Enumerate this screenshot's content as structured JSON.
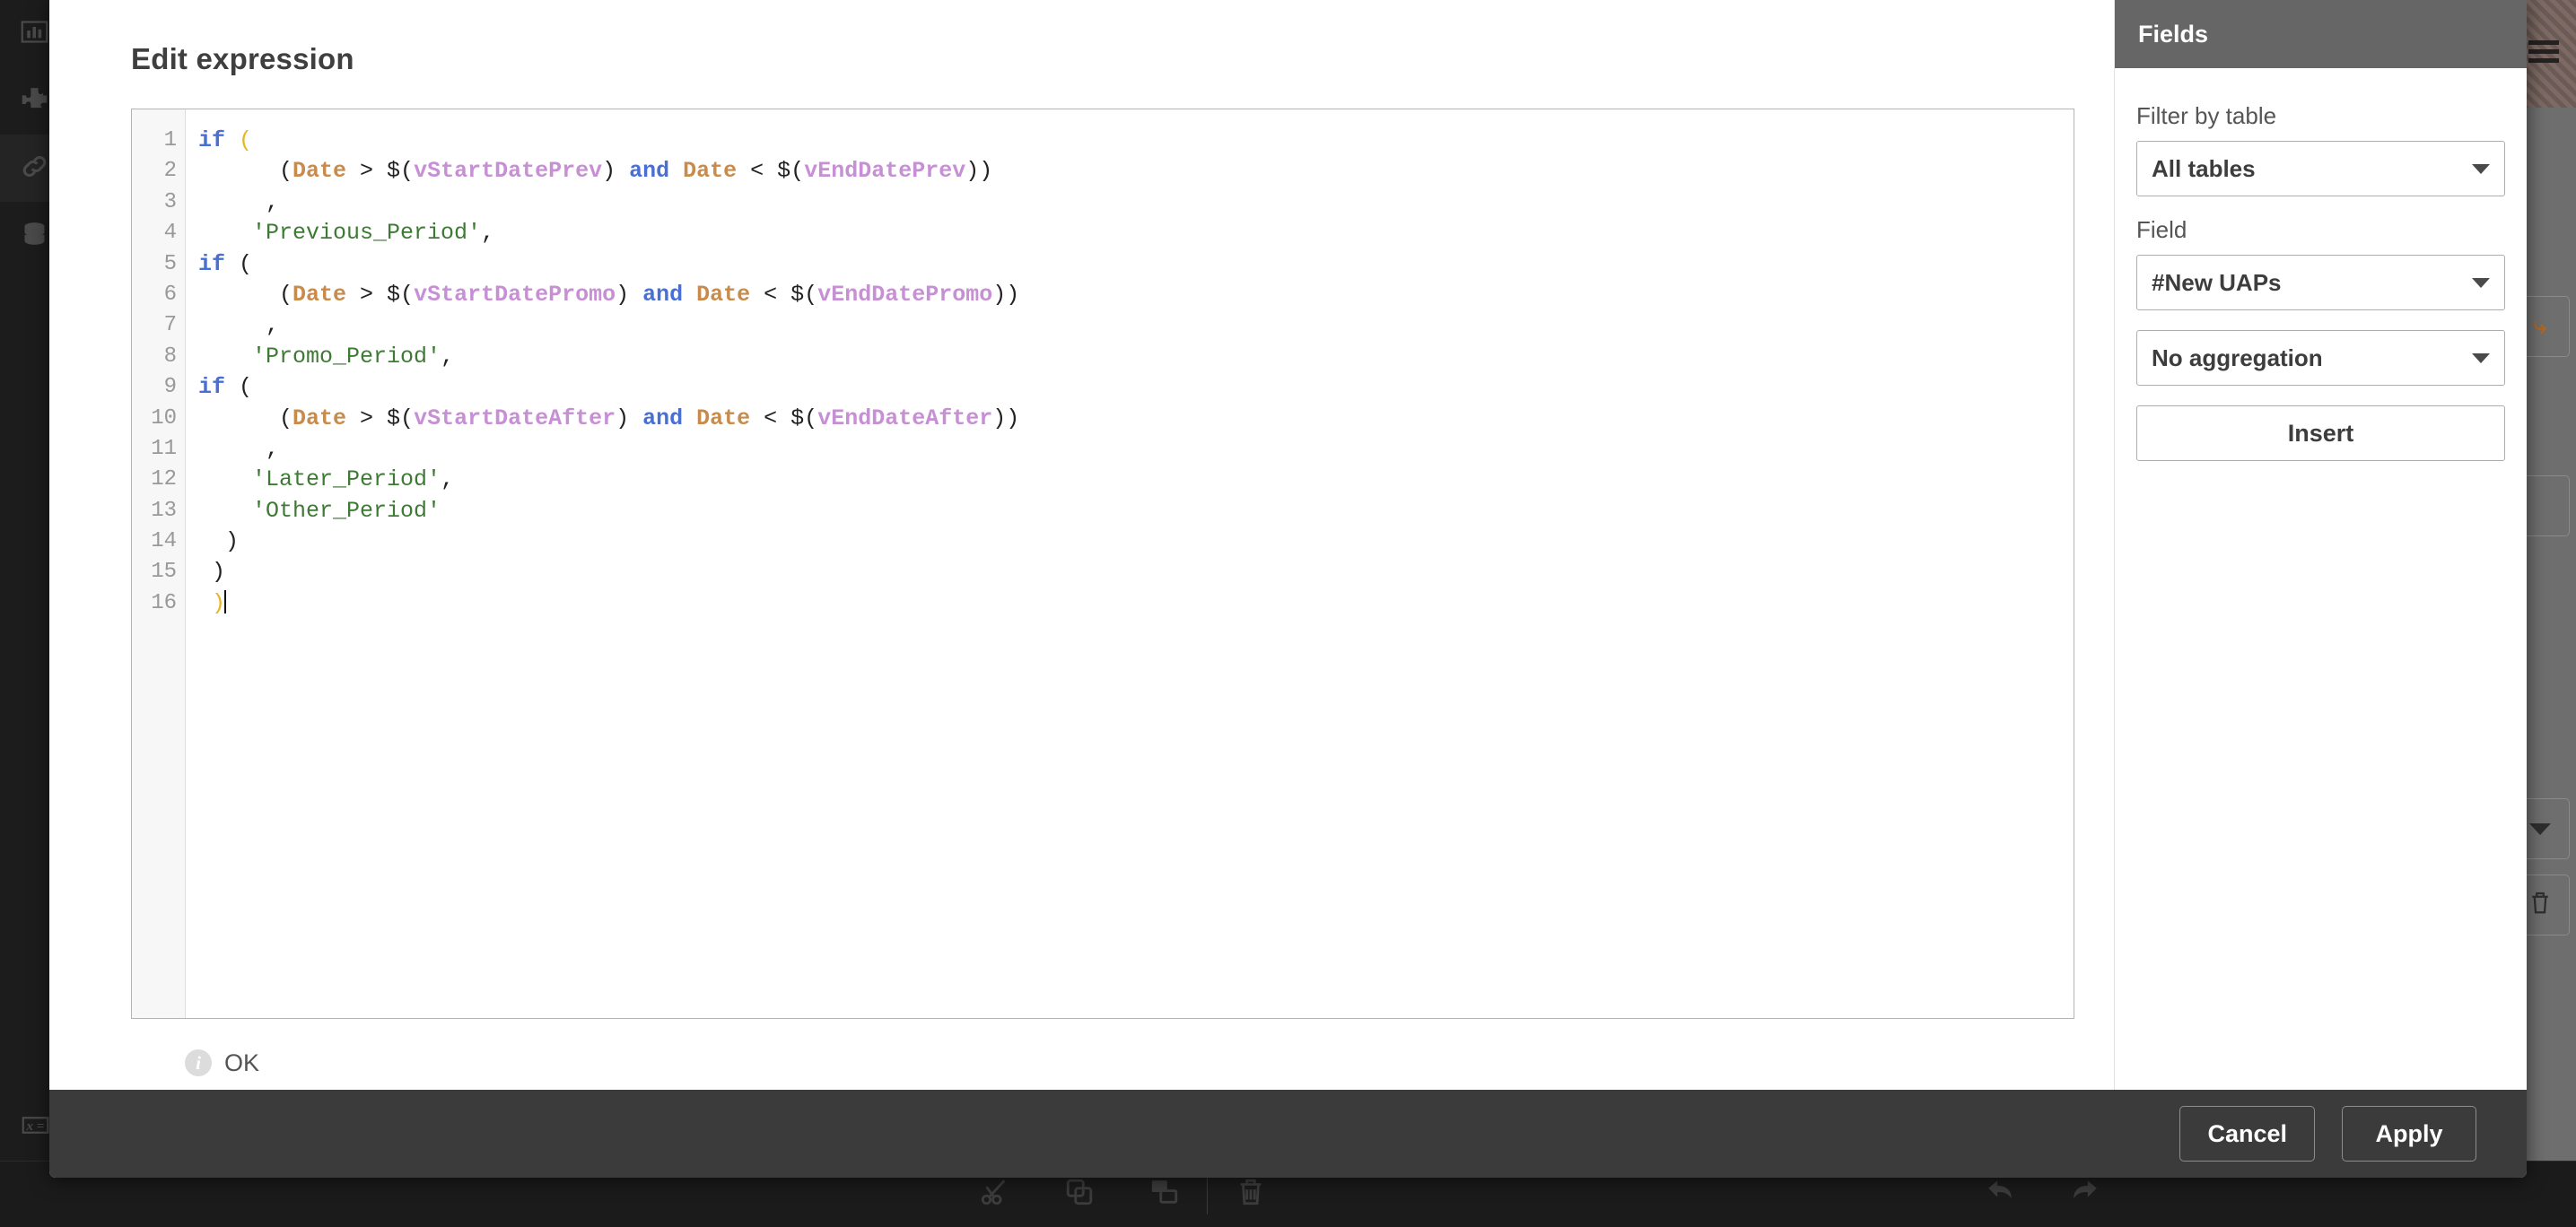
{
  "modal": {
    "title": "Edit expression",
    "status_text": "OK",
    "status_icon": "info-icon"
  },
  "code": {
    "line_numbers": [
      "1",
      "2",
      "3",
      "4",
      "5",
      "6",
      "7",
      "8",
      "9",
      "10",
      "11",
      "12",
      "13",
      "14",
      "15",
      "16"
    ],
    "lines": [
      [
        {
          "t": "if",
          "c": "kw"
        },
        {
          "t": " ",
          "c": "op"
        },
        {
          "t": "(",
          "c": "match"
        }
      ],
      [
        {
          "t": "      (",
          "c": "op"
        },
        {
          "t": "Date",
          "c": "fn"
        },
        {
          "t": " > $(",
          "c": "op"
        },
        {
          "t": "vStartDatePrev",
          "c": "var"
        },
        {
          "t": ") ",
          "c": "op"
        },
        {
          "t": "and",
          "c": "kw"
        },
        {
          "t": " ",
          "c": "op"
        },
        {
          "t": "Date",
          "c": "fn"
        },
        {
          "t": " < $(",
          "c": "op"
        },
        {
          "t": "vEndDatePrev",
          "c": "var"
        },
        {
          "t": "))",
          "c": "op"
        }
      ],
      [
        {
          "t": "     ,",
          "c": "op"
        }
      ],
      [
        {
          "t": "    ",
          "c": "op"
        },
        {
          "t": "'Previous_Period'",
          "c": "str"
        },
        {
          "t": ",",
          "c": "op"
        }
      ],
      [
        {
          "t": "if",
          "c": "kw"
        },
        {
          "t": " (",
          "c": "op"
        }
      ],
      [
        {
          "t": "      (",
          "c": "op"
        },
        {
          "t": "Date",
          "c": "fn"
        },
        {
          "t": " > $(",
          "c": "op"
        },
        {
          "t": "vStartDatePromo",
          "c": "var"
        },
        {
          "t": ") ",
          "c": "op"
        },
        {
          "t": "and",
          "c": "kw"
        },
        {
          "t": " ",
          "c": "op"
        },
        {
          "t": "Date",
          "c": "fn"
        },
        {
          "t": " < $(",
          "c": "op"
        },
        {
          "t": "vEndDatePromo",
          "c": "var"
        },
        {
          "t": "))",
          "c": "op"
        }
      ],
      [
        {
          "t": "     ,",
          "c": "op"
        }
      ],
      [
        {
          "t": "    ",
          "c": "op"
        },
        {
          "t": "'Promo_Period'",
          "c": "str"
        },
        {
          "t": ",",
          "c": "op"
        }
      ],
      [
        {
          "t": "if",
          "c": "kw"
        },
        {
          "t": " (",
          "c": "op"
        }
      ],
      [
        {
          "t": "      (",
          "c": "op"
        },
        {
          "t": "Date",
          "c": "fn"
        },
        {
          "t": " > $(",
          "c": "op"
        },
        {
          "t": "vStartDateAfter",
          "c": "var"
        },
        {
          "t": ") ",
          "c": "op"
        },
        {
          "t": "and",
          "c": "kw"
        },
        {
          "t": " ",
          "c": "op"
        },
        {
          "t": "Date",
          "c": "fn"
        },
        {
          "t": " < $(",
          "c": "op"
        },
        {
          "t": "vEndDateAfter",
          "c": "var"
        },
        {
          "t": "))",
          "c": "op"
        }
      ],
      [
        {
          "t": "     ,",
          "c": "op"
        }
      ],
      [
        {
          "t": "    ",
          "c": "op"
        },
        {
          "t": "'Later_Period'",
          "c": "str"
        },
        {
          "t": ",",
          "c": "op"
        }
      ],
      [
        {
          "t": "    ",
          "c": "op"
        },
        {
          "t": "'Other_Period'",
          "c": "str"
        }
      ],
      [
        {
          "t": "  )",
          "c": "op"
        }
      ],
      [
        {
          "t": " )",
          "c": "op"
        }
      ],
      [
        {
          "t": " ",
          "c": "op"
        },
        {
          "t": ")",
          "c": "match"
        },
        {
          "t": "|CARET|",
          "c": "caret"
        }
      ]
    ],
    "colors": {
      "keyword": "#4a6fd4",
      "function": "#c98b4b",
      "variable": "#c78fd4",
      "string": "#3d7a33",
      "operator": "#222222",
      "matching_bracket": "#e8b620"
    }
  },
  "fields_panel": {
    "header": "Fields",
    "filter_label": "Filter by table",
    "filter_value": "All tables",
    "field_label": "Field",
    "field_value": "#New UAPs",
    "aggregation_value": "No aggregation",
    "insert_label": "Insert"
  },
  "footer": {
    "cancel_label": "Cancel",
    "apply_label": "Apply"
  },
  "left_rail": {
    "items": [
      {
        "icon": "chart-icon"
      },
      {
        "icon": "puzzle-icon"
      },
      {
        "icon": "link-icon"
      },
      {
        "icon": "database-icon"
      }
    ],
    "bottom_item": {
      "icon": "variables-icon",
      "label": "x ="
    }
  },
  "bottom_toolbar": {
    "items": [
      {
        "icon": "cut-icon"
      },
      {
        "icon": "copy-icon"
      },
      {
        "icon": "paste-icon"
      },
      {
        "icon": "delete-icon"
      },
      {
        "icon": "undo-icon"
      },
      {
        "icon": "redo-icon"
      }
    ]
  },
  "right_rail": {
    "items": [
      {
        "icon": "hamburger-icon"
      },
      {
        "icon": "brush-icon"
      },
      {
        "icon": "blank-box-icon"
      },
      {
        "icon": "chevron-down-icon"
      },
      {
        "icon": "trash-icon"
      }
    ]
  }
}
